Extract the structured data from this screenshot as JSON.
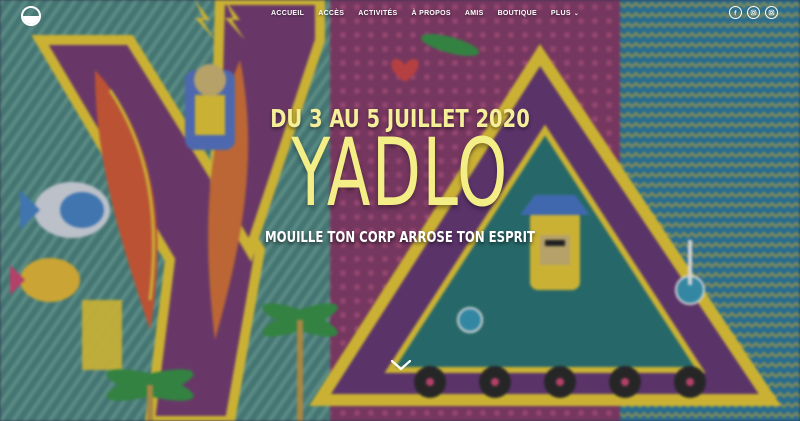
{
  "logo": {
    "icon": "half-circle-logo-icon"
  },
  "nav": {
    "items": [
      {
        "label": "ACCUEIL"
      },
      {
        "label": "ACCÈS"
      },
      {
        "label": "ACTIVITÉS"
      },
      {
        "label": "À PROPOS"
      },
      {
        "label": "AMIS"
      },
      {
        "label": "BOUTIQUE"
      },
      {
        "label": "PLUS"
      }
    ]
  },
  "social": [
    "facebook-icon",
    "instagram-icon",
    "instagram-icon"
  ],
  "hero": {
    "dates": "DU 3 AU 5 JUILLET 2020",
    "title": "YADLO",
    "tagline": "MOUILLE TON CORP ARROSE TON ESPRIT",
    "scroll_icon": "chevron-down-icon"
  },
  "colors": {
    "title": "#f4ee86",
    "accent_yellow": "#f2d43a",
    "purple": "#7a3a8a",
    "pink": "#d84a7a",
    "teal": "#3aa0a0"
  }
}
